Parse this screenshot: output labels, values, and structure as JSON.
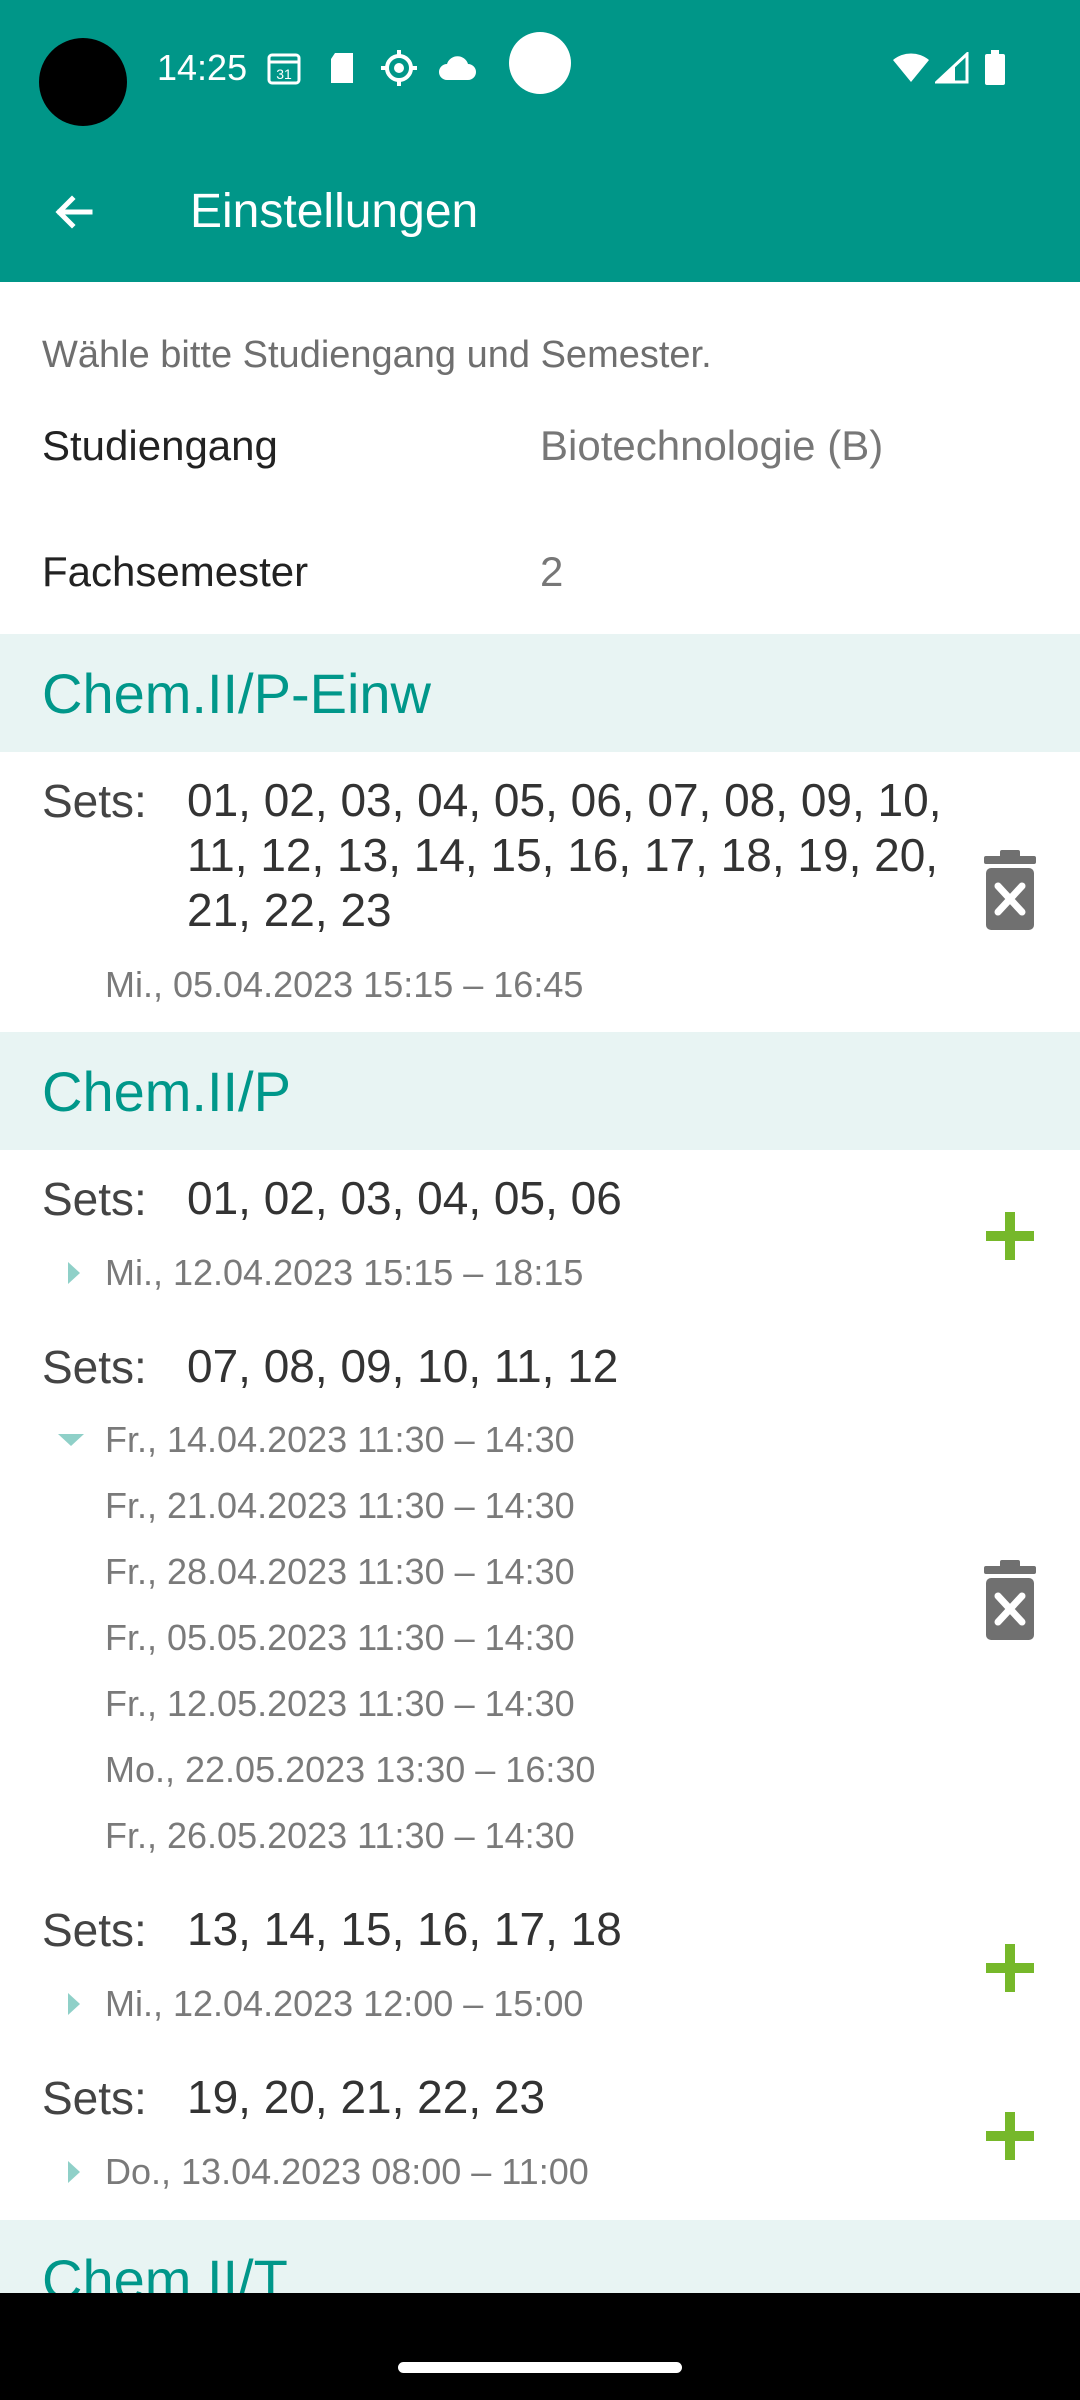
{
  "status_bar": {
    "time": "14:25",
    "icons": [
      "calendar-icon",
      "sd-card-icon",
      "settings-gear-icon",
      "cloud-icon",
      "wifi-icon",
      "signal-icon",
      "battery-icon"
    ]
  },
  "toolbar": {
    "title": "Einstellungen",
    "back_icon": "arrow-left-icon"
  },
  "settings": {
    "hint": "Wähle bitte Studiengang und Semester.",
    "studiengang_label": "Studiengang",
    "studiengang_value": "Biotechnologie (B)",
    "fachsemester_label": "Fachsemester",
    "fachsemester_value": "2"
  },
  "sections": [
    {
      "title": "Chem.II/P-Einw",
      "groups": [
        {
          "sets_label": "Sets:",
          "sets": "01, 02, 03, 04, 05, 06, 07, 08, 09, 10, 11, 12, 13, 14, 15, 16, 17, 18, 19, 20, 21, 22, 23",
          "dates": [
            "Mi., 05.04.2023 15:15 – 16:45"
          ],
          "action": "delete-icon"
        }
      ]
    },
    {
      "title": "Chem.II/P",
      "groups": [
        {
          "sets_label": "Sets:",
          "sets": "01, 02, 03, 04, 05, 06",
          "dates": [
            "Mi., 12.04.2023 15:15 – 18:15"
          ],
          "action": "add-icon"
        },
        {
          "sets_label": "Sets:",
          "sets": "07, 08, 09, 10, 11, 12",
          "dates": [
            "Fr., 14.04.2023 11:30 – 14:30",
            "Fr., 21.04.2023 11:30 – 14:30",
            "Fr., 28.04.2023 11:30 – 14:30",
            "Fr., 05.05.2023 11:30 – 14:30",
            "Fr., 12.05.2023 11:30 – 14:30",
            "Mo., 22.05.2023 13:30 – 16:30",
            "Fr., 26.05.2023 11:30 – 14:30"
          ],
          "action": "delete-icon"
        },
        {
          "sets_label": "Sets:",
          "sets": "13, 14, 15, 16, 17, 18",
          "dates": [
            "Mi., 12.04.2023 12:00 – 15:00"
          ],
          "action": "add-icon"
        },
        {
          "sets_label": "Sets:",
          "sets": "19, 20, 21, 22, 23",
          "dates": [
            "Do., 13.04.2023 08:00 – 11:00"
          ],
          "action": "add-icon"
        }
      ]
    },
    {
      "title": "Chem.II/T"
    }
  ],
  "colors": {
    "primary": "#009688",
    "section_bg": "#e8f4f3",
    "section_title": "#00978a",
    "add_green": "#76b82a",
    "delete_gray": "#707070"
  }
}
